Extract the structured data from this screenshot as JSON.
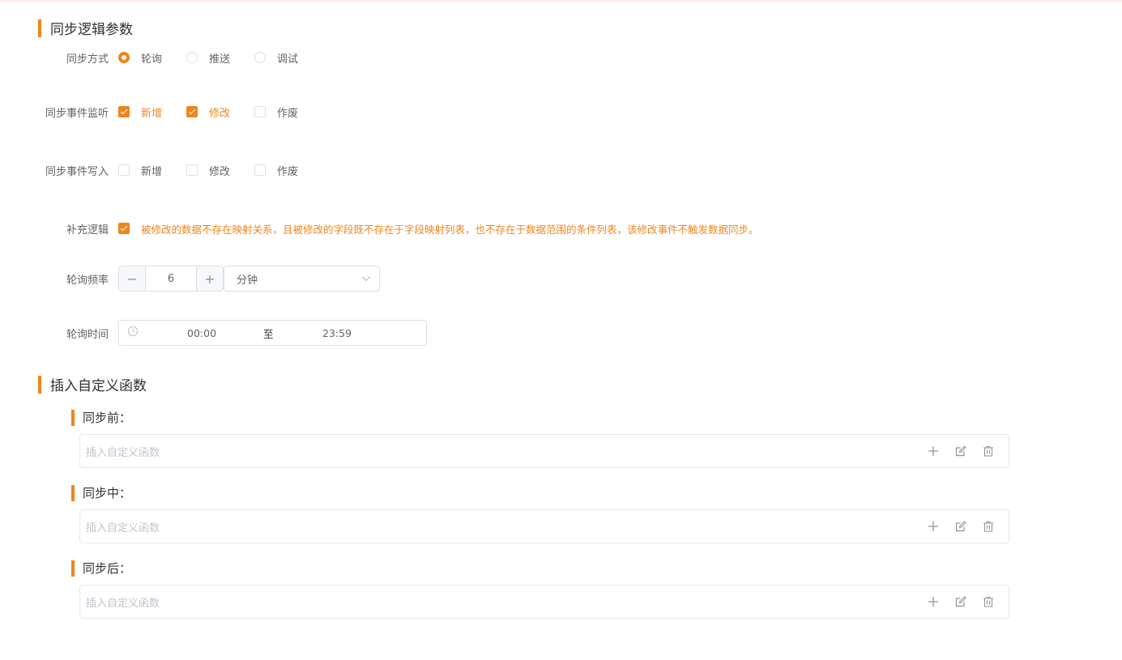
{
  "section1": {
    "title": "同步逻辑参数"
  },
  "sync_mode": {
    "label": "同步方式",
    "options": [
      {
        "label": "轮询",
        "selected": true
      },
      {
        "label": "推送",
        "selected": false
      },
      {
        "label": "调试",
        "selected": false
      }
    ]
  },
  "event_listen": {
    "label": "同步事件监听",
    "options": [
      {
        "label": "新增",
        "checked": true
      },
      {
        "label": "修改",
        "checked": true
      },
      {
        "label": "作废",
        "checked": false
      }
    ]
  },
  "event_write": {
    "label": "同步事件写入",
    "options": [
      {
        "label": "新增",
        "checked": false
      },
      {
        "label": "修改",
        "checked": false
      },
      {
        "label": "作废",
        "checked": false
      }
    ]
  },
  "supplement": {
    "label": "补充逻辑",
    "checked": true,
    "text": "被修改的数据不存在映射关系，且被修改的字段既不存在于字段映射列表，也不存在于数据范围的条件列表，该修改事件不触发数据同步。"
  },
  "poll_freq": {
    "label": "轮询频率",
    "value": "6",
    "minus": "−",
    "plus": "+",
    "unit": "分钟"
  },
  "poll_time": {
    "label": "轮询时间",
    "start": "00:00",
    "separator": "至",
    "end": "23:59"
  },
  "section2": {
    "title": "插入自定义函数"
  },
  "functions": [
    {
      "title": "同步前：",
      "placeholder": "插入自定义函数"
    },
    {
      "title": "同步中：",
      "placeholder": "插入自定义函数"
    },
    {
      "title": "同步后：",
      "placeholder": "插入自定义函数"
    }
  ],
  "colors": {
    "accent": "#f0841c",
    "border": "#dcdfe6",
    "text": "#606266",
    "placeholder": "#c0c4cc"
  }
}
